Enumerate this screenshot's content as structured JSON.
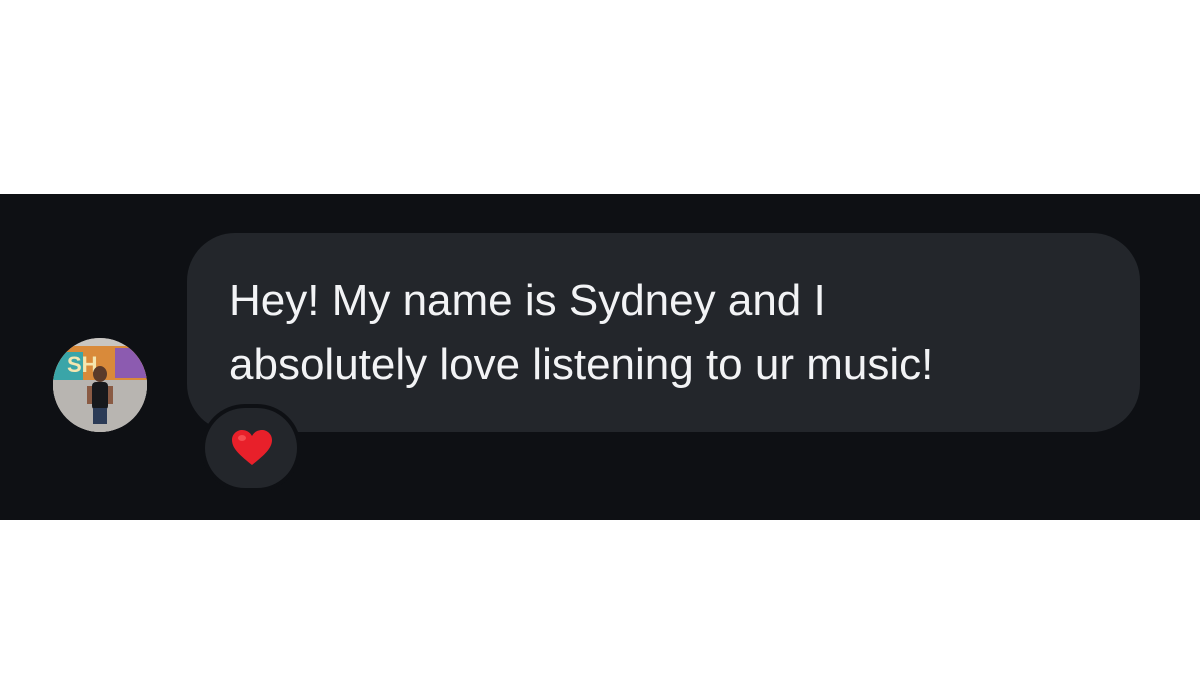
{
  "message": {
    "lines": [
      "Hey! My name is Sydney and I",
      "absolutely love listening to ur music!"
    ]
  },
  "reaction": {
    "icon": "red-heart-icon",
    "color": "#e8202a"
  },
  "avatar": {
    "icon": "profile-photo"
  },
  "colors": {
    "background": "#0e1014",
    "bubble": "#23262b",
    "text": "#f2f3f5"
  }
}
